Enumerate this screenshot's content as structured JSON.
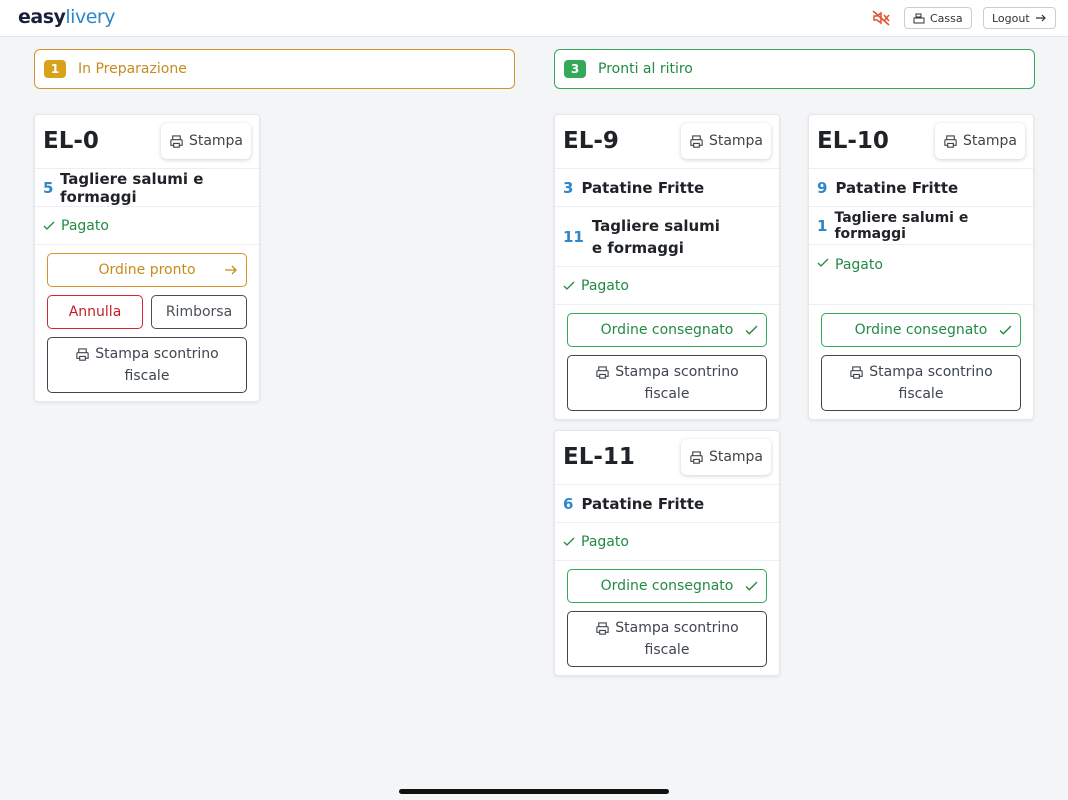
{
  "header": {
    "logo_part1": "easy",
    "logo_part2": "livery",
    "cassa_label": "Cassa",
    "logout_label": "Logout",
    "mute_icon": "speaker-muted-icon"
  },
  "columns": [
    {
      "count": "1",
      "title": "In Preparazione",
      "color": "#d5942b"
    },
    {
      "count": "3",
      "title": "Pronti al ritiro",
      "color": "#35a95a"
    }
  ],
  "labels": {
    "stampa": "Stampa",
    "pagato": "Pagato",
    "ordine_pronto": "Ordine pronto",
    "ordine_consegnato": "Ordine consegnato",
    "annulla": "Annulla",
    "rimborsa": "Rimborsa",
    "scontrino_l1": "Stampa scontrino",
    "scontrino_l2": "fiscale"
  },
  "orders": {
    "el0": {
      "code": "EL-0",
      "items": [
        {
          "qty": "5",
          "name": "Tagliere salumi e formaggi"
        }
      ]
    },
    "el9": {
      "code": "EL-9",
      "items": [
        {
          "qty": "3",
          "name": "Patatine Fritte"
        },
        {
          "qty": "11",
          "name": "Tagliere salumi e formaggi"
        }
      ]
    },
    "el10": {
      "code": "EL-10",
      "items": [
        {
          "qty": "9",
          "name": "Patatine Fritte"
        },
        {
          "qty": "1",
          "name": "Tagliere salumi e formaggi"
        }
      ]
    },
    "el11": {
      "code": "EL-11",
      "items": [
        {
          "qty": "6",
          "name": "Patatine Fritte"
        }
      ]
    }
  }
}
